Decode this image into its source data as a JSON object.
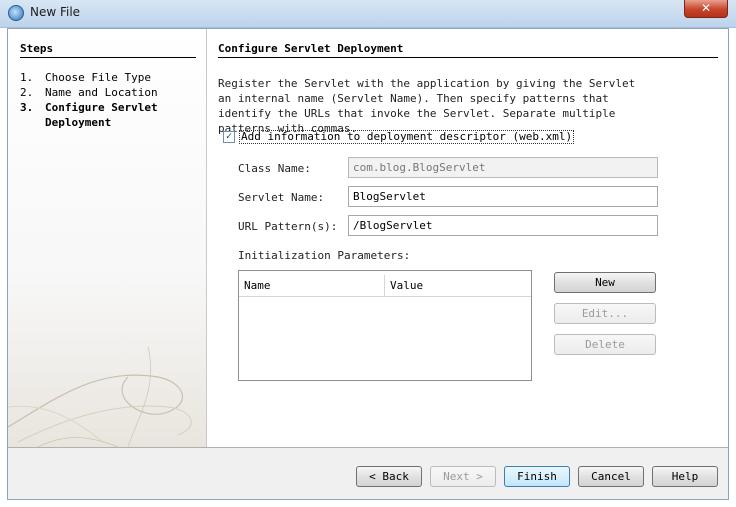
{
  "window": {
    "title": "New File",
    "close_glyph": "✕"
  },
  "steps": {
    "title": "Steps",
    "items": [
      {
        "num": "1.",
        "label": "Choose File Type"
      },
      {
        "num": "2.",
        "label": "Name and Location"
      },
      {
        "num": "3.",
        "label": "Configure Servlet Deployment"
      }
    ],
    "current_index": 2
  },
  "panel": {
    "title": "Configure Servlet Deployment",
    "description": "Register the Servlet with the application by giving the Servlet an internal name (Servlet Name). Then specify patterns that identify the URLs that invoke the Servlet. Separate multiple patterns with commas.",
    "add_descriptor": {
      "checked": true,
      "label": "Add information to deployment descriptor (web.xml)"
    },
    "class_name": {
      "label": "Class Name:",
      "value": "com.blog.BlogServlet"
    },
    "servlet_name": {
      "label": "Servlet Name:",
      "value": "BlogServlet"
    },
    "url_pattern": {
      "label": "URL Pattern(s):",
      "value": "/BlogServlet"
    },
    "init_params": {
      "label": "Initialization Parameters:",
      "columns": [
        "Name",
        "Value"
      ],
      "rows": []
    },
    "buttons": {
      "new": "New",
      "edit": "Edit...",
      "delete": "Delete"
    }
  },
  "footer": {
    "back": "< Back",
    "next": "Next >",
    "finish": "Finish",
    "cancel": "Cancel",
    "help": "Help"
  },
  "colors": {
    "accent": "#3c7fb1",
    "titlebar": "#bcd3eb",
    "close": "#c7452b"
  }
}
